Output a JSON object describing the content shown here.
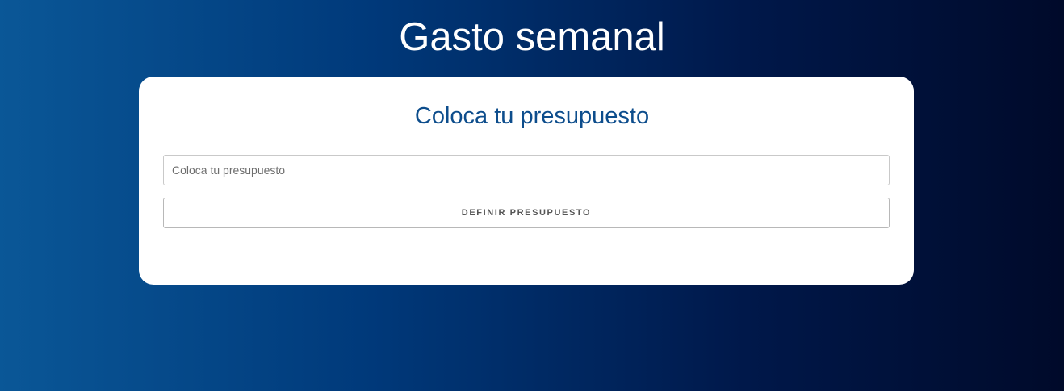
{
  "header": {
    "title": "Gasto semanal"
  },
  "budget_form": {
    "heading": "Coloca tu presupuesto",
    "input_value": "",
    "input_placeholder": "Coloca tu presupuesto",
    "submit_label": "DEFINIR PRESUPUESTO"
  },
  "colors": {
    "background_gradient_start": "#0a5797",
    "background_gradient_end": "#000a2a",
    "card_background": "#ffffff",
    "heading_color": "#0d4d8c",
    "title_color": "#ffffff"
  }
}
